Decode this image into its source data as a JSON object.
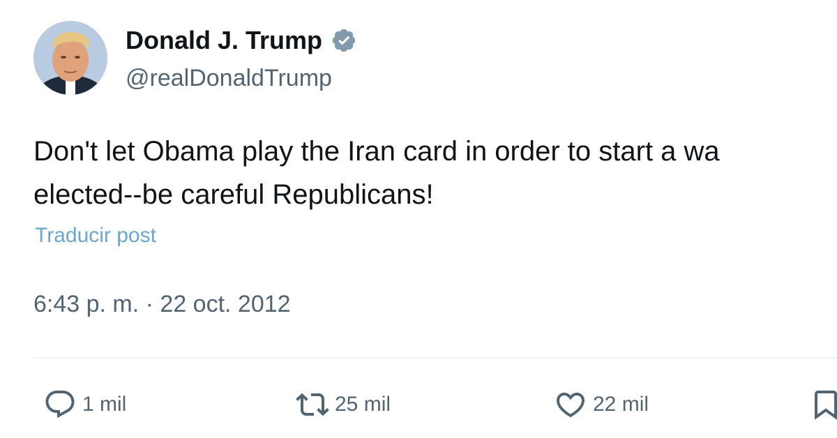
{
  "author": {
    "display_name": "Donald J. Trump",
    "handle": "@realDonaldTrump",
    "verified": true,
    "avatar_icon": "profile-photo"
  },
  "tweet": {
    "text_lines": [
      "Don't let Obama play the Iran card in order to start a wa",
      "elected--be careful Republicans!"
    ],
    "translate_label": "Traducir post",
    "timestamp": "6:43 p. m. · 22 oct. 2012"
  },
  "actions": {
    "reply": {
      "icon": "reply-icon",
      "count": "1 mil"
    },
    "retweet": {
      "icon": "retweet-icon",
      "count": "25 mil"
    },
    "like": {
      "icon": "heart-icon",
      "count": "22 mil"
    },
    "bookmark": {
      "icon": "bookmark-icon"
    }
  },
  "colors": {
    "text_primary": "#0f1419",
    "text_secondary": "#536471",
    "link": "#6aa6cf",
    "verified_badge": "#829aab",
    "divider": "#eff3f4"
  }
}
